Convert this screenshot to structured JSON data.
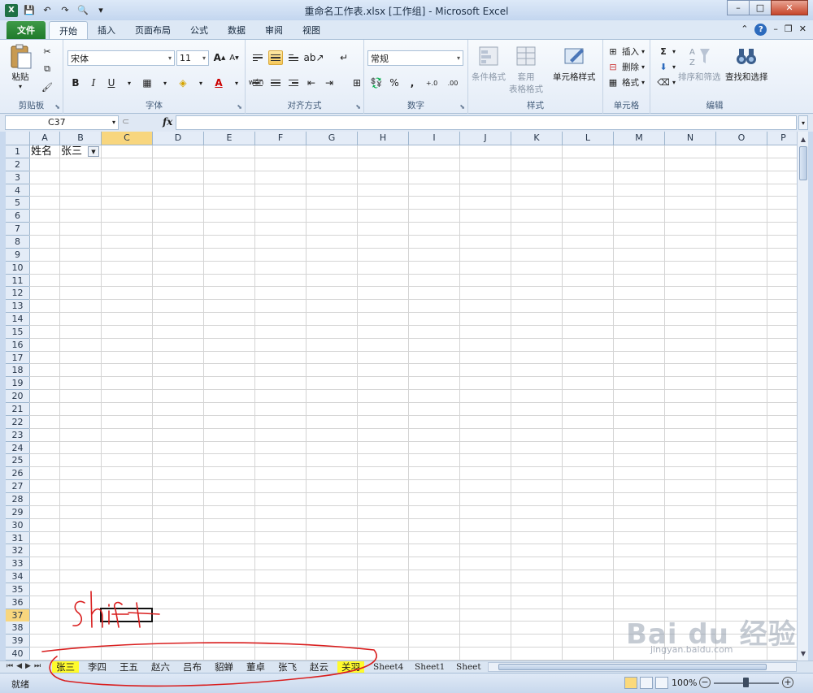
{
  "window": {
    "title": "重命名工作表.xlsx  [工作组] - Microsoft Excel",
    "min": "–",
    "max": "□",
    "close": "✕"
  },
  "ribbon_tabs": [
    "文件",
    "开始",
    "插入",
    "页面布局",
    "公式",
    "数据",
    "审阅",
    "视图"
  ],
  "ribbon": {
    "clipboard": {
      "paste": "粘贴",
      "label": "剪贴板"
    },
    "font": {
      "name": "宋体",
      "size": "11",
      "grow": "A",
      "shrink": "A",
      "bold": "B",
      "italic": "I",
      "underline": "U",
      "phonetic": "wén",
      "label": "字体"
    },
    "alignment": {
      "label": "对齐方式"
    },
    "number": {
      "format": "常规",
      "percent": "%",
      "comma": ",",
      "inc_decimal": "+.0",
      "dec_decimal": ".00",
      "label": "数字"
    },
    "styles": {
      "conditional": "条件格式",
      "table_fmt_1": "套用",
      "table_fmt_2": "表格格式",
      "cell_styles": "单元格样式",
      "label": "样式"
    },
    "cells": {
      "insert": "插入",
      "delete": "删除",
      "format": "格式",
      "label": "单元格"
    },
    "editing": {
      "sigma": "Σ",
      "sort_filter": "排序和筛选",
      "find_select": "查找和选择",
      "label": "编辑"
    }
  },
  "formula_bar": {
    "name_box": "C37",
    "fx": "fx",
    "value": ""
  },
  "sheet": {
    "columns": [
      "A",
      "B",
      "C",
      "D",
      "E",
      "F",
      "G",
      "H",
      "I",
      "J",
      "K",
      "L",
      "M",
      "N",
      "O",
      "P"
    ],
    "selected_column": "C",
    "rows": 40,
    "selected_row": 37,
    "active_cell": "C37",
    "cells": [
      {
        "ref": "A1",
        "value": "姓名"
      },
      {
        "ref": "B1",
        "value": "张三"
      }
    ]
  },
  "sheet_tabs": [
    {
      "name": "张三",
      "highlight": true
    },
    {
      "name": "李四",
      "highlight": false
    },
    {
      "name": "王五",
      "highlight": false
    },
    {
      "name": "赵六",
      "highlight": false
    },
    {
      "name": "吕布",
      "highlight": false
    },
    {
      "name": "貂蝉",
      "highlight": false
    },
    {
      "name": "董卓",
      "highlight": false
    },
    {
      "name": "张飞",
      "highlight": false
    },
    {
      "name": "赵云",
      "highlight": false
    },
    {
      "name": "关羽",
      "highlight": true
    },
    {
      "name": "Sheet4",
      "highlight": false
    },
    {
      "name": "Sheet1",
      "highlight": false
    },
    {
      "name": "Sheet",
      "highlight": false
    }
  ],
  "status": {
    "ready": "就绪",
    "zoom": "100%"
  },
  "annotation": {
    "handwriting": "shift",
    "color": "#d91e1e"
  },
  "watermark": {
    "brand": "Bai du 经验",
    "url": "jingyan.baidu.com"
  },
  "colors": {
    "selected_header": "#f8d67e",
    "tab_highlight": "#fffb2c",
    "file_tab": "#2a8a36"
  }
}
